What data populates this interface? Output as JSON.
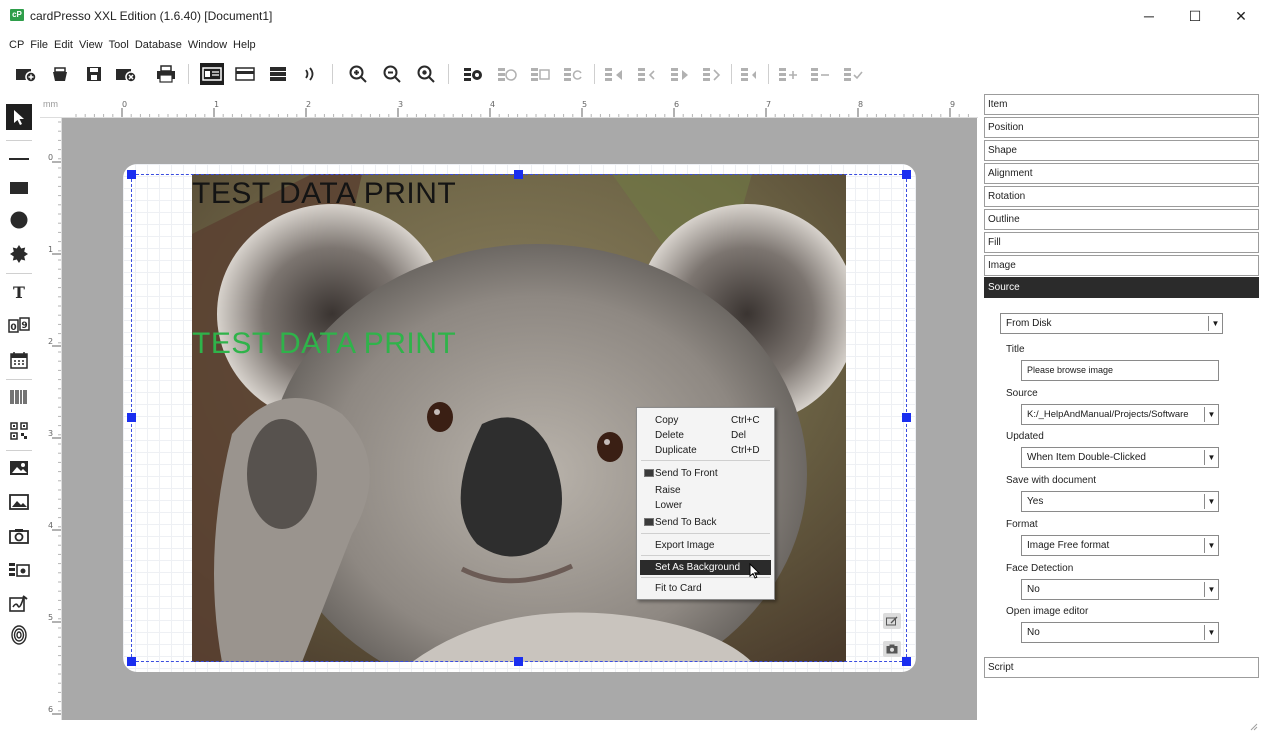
{
  "window": {
    "logo": "cP",
    "title": "cardPresso XXL Edition  (1.6.40) [Document1]",
    "controls": {
      "minimize": "─",
      "maximize": "☐",
      "close": "✕"
    }
  },
  "menu": [
    "CP",
    "File",
    "Edit",
    "View",
    "Tool",
    "Database",
    "Window",
    "Help"
  ],
  "toolbar": {
    "buttons": [
      "new-document-icon",
      "open-document-icon",
      "save-icon",
      "close-document-icon",
      "print-icon",
      "card-front-icon",
      "card-back-icon",
      "card-layers-icon",
      "encode-icon",
      "zoom-in-icon",
      "zoom-out-icon",
      "zoom-fit-icon",
      "record-view-icon",
      "record-stop-icon",
      "record-table-icon",
      "record-refresh-icon",
      "record-first-icon",
      "record-previous-icon",
      "record-next-icon",
      "record-last-icon",
      "record-undo-icon",
      "record-add-icon",
      "record-remove-icon",
      "record-accept-icon"
    ]
  },
  "palette": {
    "tools": [
      "select-tool-icon",
      "line-tool-icon",
      "rectangle-tool-icon",
      "ellipse-tool-icon",
      "star-tool-icon",
      "text-tool-icon",
      "counter-tool-icon",
      "date-tool-icon",
      "barcode-tool-icon",
      "qrcode-tool-icon",
      "image-placeholder-icon",
      "image-tool-icon",
      "camera-tool-icon",
      "photo-id-tool-icon",
      "signature-tool-icon",
      "fingerprint-tool-icon"
    ]
  },
  "ruler": {
    "unit": "mm",
    "top_labels": [
      "0",
      "1",
      "2",
      "3",
      "4",
      "5",
      "6",
      "7",
      "8",
      "9"
    ],
    "left_labels": [
      "0",
      "1",
      "2",
      "3",
      "4",
      "5",
      "6"
    ]
  },
  "card": {
    "text_black": "TEST DATA PRINT",
    "text_green": "TEST DATA PRINT",
    "text_black_color": "#141414",
    "text_green_color": "#2fb34a"
  },
  "context_menu": {
    "items": [
      {
        "label": "Copy",
        "shortcut": "Ctrl+C"
      },
      {
        "label": "Delete",
        "shortcut": "Del"
      },
      {
        "label": "Duplicate",
        "shortcut": "Ctrl+D"
      },
      {
        "label": "Send To Front",
        "shortcut": ""
      },
      {
        "label": "Raise",
        "shortcut": ""
      },
      {
        "label": "Lower",
        "shortcut": ""
      },
      {
        "label": "Send To Back",
        "shortcut": ""
      },
      {
        "label": "Export Image",
        "shortcut": ""
      },
      {
        "label": "Set As Background",
        "shortcut": ""
      },
      {
        "label": "Fit to Card",
        "shortcut": ""
      }
    ],
    "highlighted": "Set As Background"
  },
  "properties": {
    "sections": [
      "Item",
      "Position",
      "Shape",
      "Alignment",
      "Rotation",
      "Outline",
      "Fill",
      "Image",
      "Source"
    ],
    "active_section": "Source",
    "source_type": "From Disk",
    "fields": {
      "title_label": "Title",
      "title_value": "Please browse image",
      "source_label": "Source",
      "source_value": "K:/_HelpAndManual/Projects/Software",
      "updated_label": "Updated",
      "updated_value": "When Item Double-Clicked",
      "save_label": "Save with document",
      "save_value": "Yes",
      "format_label": "Format",
      "format_value": "Image Free format",
      "face_label": "Face Detection",
      "face_value": "No",
      "editor_label": "Open image editor",
      "editor_value": "No"
    },
    "script_section": "Script"
  },
  "colors": {
    "accent_dark": "#2b2b2b",
    "selection_handle": "#1a2ef0",
    "canvas_background": "#a9a9a9"
  }
}
